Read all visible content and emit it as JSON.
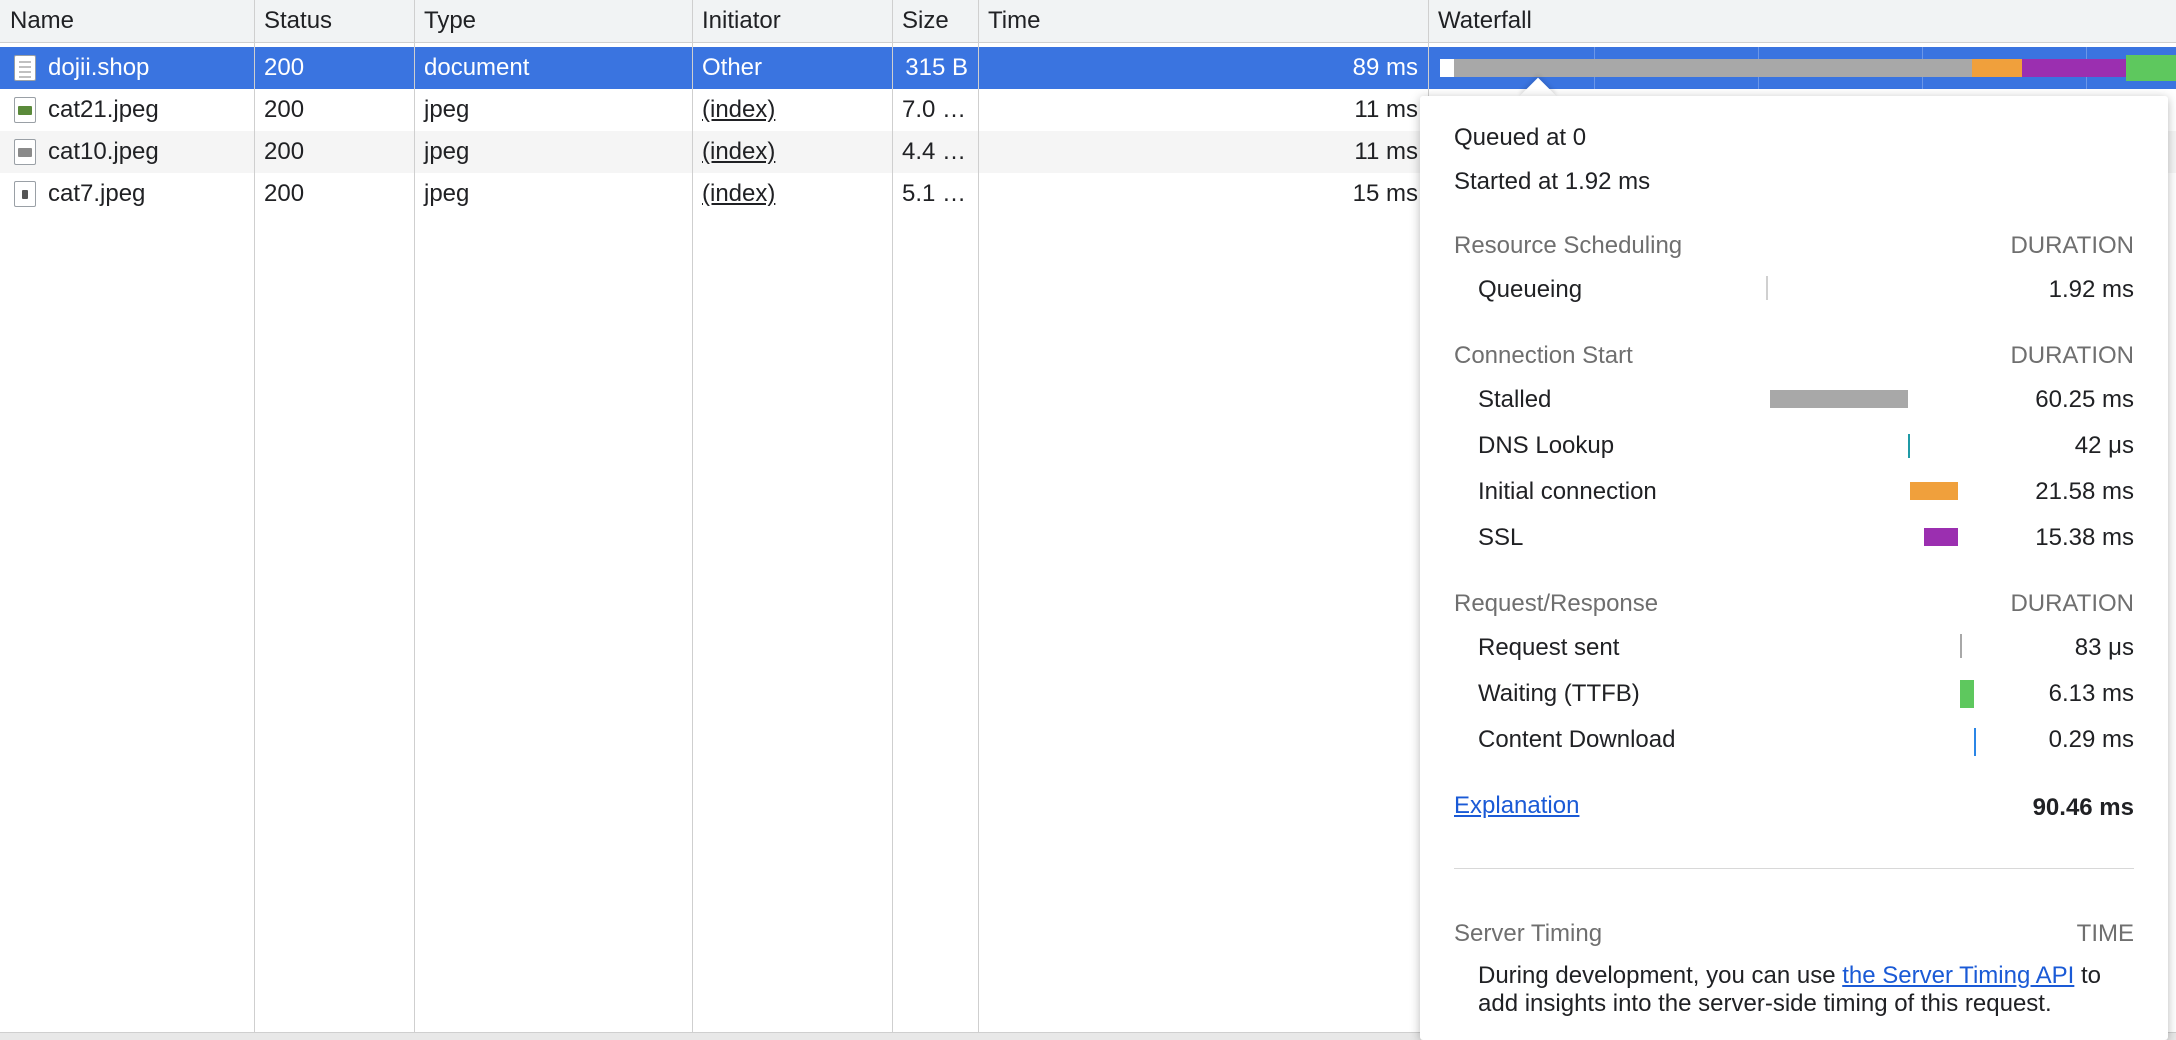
{
  "columns": [
    "Name",
    "Status",
    "Type",
    "Initiator",
    "Size",
    "Time",
    "Waterfall"
  ],
  "rows": [
    {
      "name": "dojii.shop",
      "status": "200",
      "type": "document",
      "initiator": "Other",
      "size": "315 B",
      "time": "89 ms",
      "icon": "document-file-icon"
    },
    {
      "name": "cat21.jpeg",
      "status": "200",
      "type": "jpeg",
      "initiator": "(index)",
      "size": "7.0 …",
      "time": "11 ms",
      "icon": "image-file-icon"
    },
    {
      "name": "cat10.jpeg",
      "status": "200",
      "type": "jpeg",
      "initiator": "(index)",
      "size": "4.4 …",
      "time": "11 ms",
      "icon": "image-file-icon"
    },
    {
      "name": "cat7.jpeg",
      "status": "200",
      "type": "jpeg",
      "initiator": "(index)",
      "size": "5.1 …",
      "time": "15 ms",
      "icon": "image-file-icon"
    }
  ],
  "timing": {
    "queued_at": "Queued at 0",
    "started_at": "Started at 1.92 ms",
    "duration_header": "DURATION",
    "resource_scheduling": {
      "title": "Resource Scheduling",
      "items": [
        {
          "label": "Queueing",
          "value": "1.92 ms"
        }
      ]
    },
    "connection_start": {
      "title": "Connection Start",
      "items": [
        {
          "label": "Stalled",
          "value": "60.25 ms"
        },
        {
          "label": "DNS Lookup",
          "value": "42 μs"
        },
        {
          "label": "Initial connection",
          "value": "21.58 ms"
        },
        {
          "label": "SSL",
          "value": "15.38 ms"
        }
      ]
    },
    "request_response": {
      "title": "Request/Response",
      "items": [
        {
          "label": "Request sent",
          "value": "83 μs"
        },
        {
          "label": "Waiting (TTFB)",
          "value": "6.13 ms"
        },
        {
          "label": "Content Download",
          "value": "0.29 ms"
        }
      ]
    },
    "explanation_link": "Explanation",
    "total": "90.46 ms",
    "server_timing": {
      "title": "Server Timing",
      "time_header": "TIME",
      "text_before": "During development, you can use ",
      "link": "the Server Timing API",
      "text_after": " to",
      "line2": "add insights into the server-side timing of this request."
    }
  },
  "colors": {
    "selected_row": "#3a74e0",
    "stalled": "#a8a8a8",
    "dns": "#1f9aa6",
    "initial_connection": "#f0a03c",
    "ssl": "#9b2fb0",
    "ttfb": "#5ec85e",
    "download": "#2b86e6",
    "link": "#1a5ad6"
  }
}
